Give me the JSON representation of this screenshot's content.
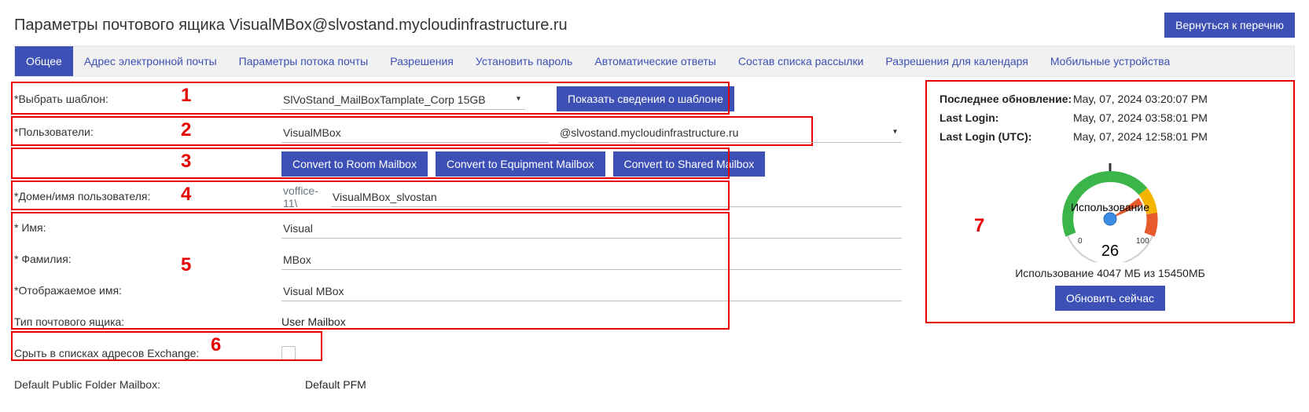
{
  "header": {
    "title": "Параметры почтового ящика VisualMBox@slvostand.mycloudinfrastructure.ru",
    "back_button": "Вернуться к перечню"
  },
  "tabs": [
    "Общее",
    "Адрес электронной почты",
    "Параметры потока почты",
    "Разрешения",
    "Установить пароль",
    "Автоматические ответы",
    "Состав списка рассылки",
    "Разрешения для календаря",
    "Мобильные устройства"
  ],
  "markers": {
    "n1": "1",
    "n2": "2",
    "n3": "3",
    "n4": "4",
    "n5": "5",
    "n6": "6",
    "n7": "7"
  },
  "form": {
    "template_label": "*Выбрать шаблон:",
    "template_value": "SlVoStand_MailBoxTamplate_Corp 15GB",
    "template_btn": "Показать сведения о шаблоне",
    "users_label": "*Пользователи:",
    "users_value": "VisualMBox",
    "users_domain": "@slvostand.mycloudinfrastructure.ru",
    "convert_room": "Convert to Room Mailbox",
    "convert_equipment": "Convert to Equipment Mailbox",
    "convert_shared": "Convert to Shared Mailbox",
    "domain_user_label": "*Домен/имя пользователя:",
    "domain_prefix": "voffice-11\\",
    "domain_username": "VisualMBox_slvostan",
    "firstname_label": "* Имя:",
    "firstname_value": "Visual",
    "lastname_label": "* Фамилия:",
    "lastname_value": "MBox",
    "display_label": "*Отображаемое имя:",
    "display_value": "Visual MBox",
    "type_label": "Тип почтового ящика:",
    "type_value": "User Mailbox",
    "hide_label": "Срыть в списках адресов Exchange:",
    "pfm_label": "Default Public Folder Mailbox:",
    "pfm_value": "Default PFM"
  },
  "info": {
    "last_update_label": "Последнее обновление:",
    "last_update_value": "May, 07, 2024 03:20:07 PM",
    "last_login_label": "Last Login:",
    "last_login_value": "May, 07, 2024 03:58:01 PM",
    "last_login_utc_label": "Last Login (UTC):",
    "last_login_utc_value": "May, 07, 2024 12:58:01 PM",
    "gauge_label": "Использование",
    "gauge_value": "26",
    "gauge_min": "0",
    "gauge_max": "100",
    "usage_caption": "Использование 4047 МБ из 15450МБ",
    "refresh_btn": "Обновить сейчас"
  },
  "chart_data": {
    "type": "gauge",
    "title": "Использование",
    "value": 26,
    "min": 0,
    "max": 100,
    "unit": "percent",
    "used_mb": 4047,
    "total_mb": 15450,
    "segments": [
      {
        "from": 0,
        "to": 60,
        "color": "#3bb54a"
      },
      {
        "from": 60,
        "to": 80,
        "color": "#f5b400"
      },
      {
        "from": 80,
        "to": 100,
        "color": "#e65a2e"
      }
    ]
  }
}
